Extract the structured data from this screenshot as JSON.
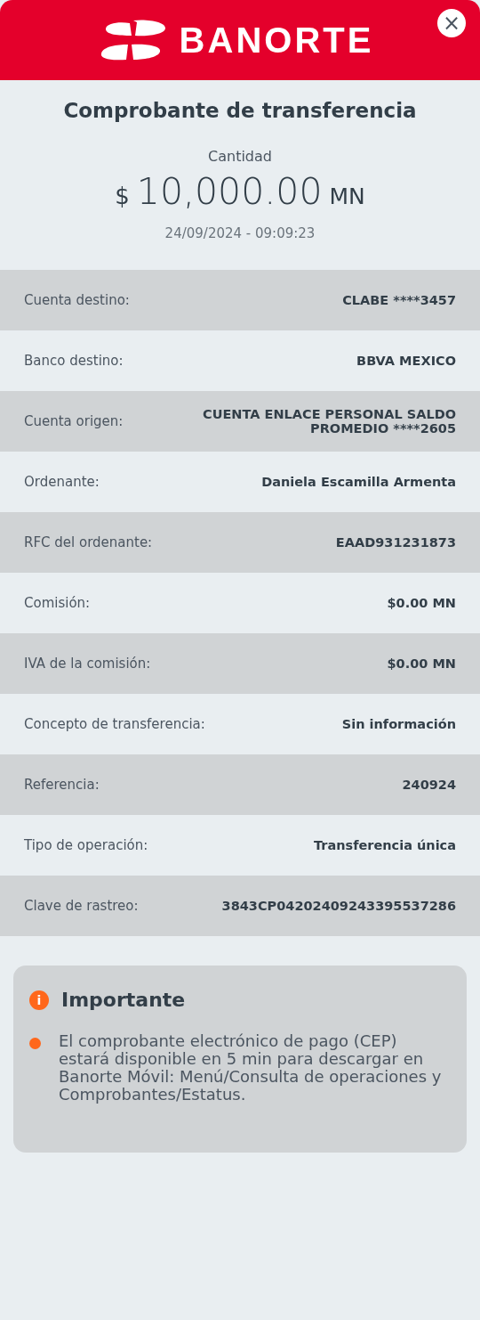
{
  "header": {
    "logo_text": "BANORTE",
    "close": "×"
  },
  "title": "Comprobante de transferencia",
  "amount": {
    "label": "Cantidad",
    "currency": "$",
    "value": "10,000.00",
    "unit": "MN",
    "datetime": "24/09/2024 - 09:09:23"
  },
  "details": [
    {
      "label": "Cuenta destino:",
      "value": "CLABE ****3457"
    },
    {
      "label": "Banco destino:",
      "value": "BBVA MEXICO"
    },
    {
      "label": "Cuenta origen:",
      "value": "CUENTA ENLACE PERSONAL SALDO PROMEDIO ****2605"
    },
    {
      "label": "Ordenante:",
      "value": "Daniela Escamilla Armenta"
    },
    {
      "label": "RFC del ordenante:",
      "value": "EAAD931231873"
    },
    {
      "label": "Comisión:",
      "value": "$0.00 MN"
    },
    {
      "label": "IVA de la comisión:",
      "value": "$0.00 MN"
    },
    {
      "label": "Concepto de transferencia:",
      "value": "Sin información"
    },
    {
      "label": "Referencia:",
      "value": "240924"
    },
    {
      "label": "Tipo de operación:",
      "value": "Transferencia única"
    },
    {
      "label": "Clave de rastreo:",
      "value": "3843CP04202409243395537286"
    }
  ],
  "notice": {
    "title": "Importante",
    "icon": "i",
    "items": [
      "El comprobante electrónico de pago (CEP) estará disponible en 5 min para descargar en Banorte Móvil: Menú/Consulta de operaciones y Comprobantes/Estatus."
    ]
  }
}
